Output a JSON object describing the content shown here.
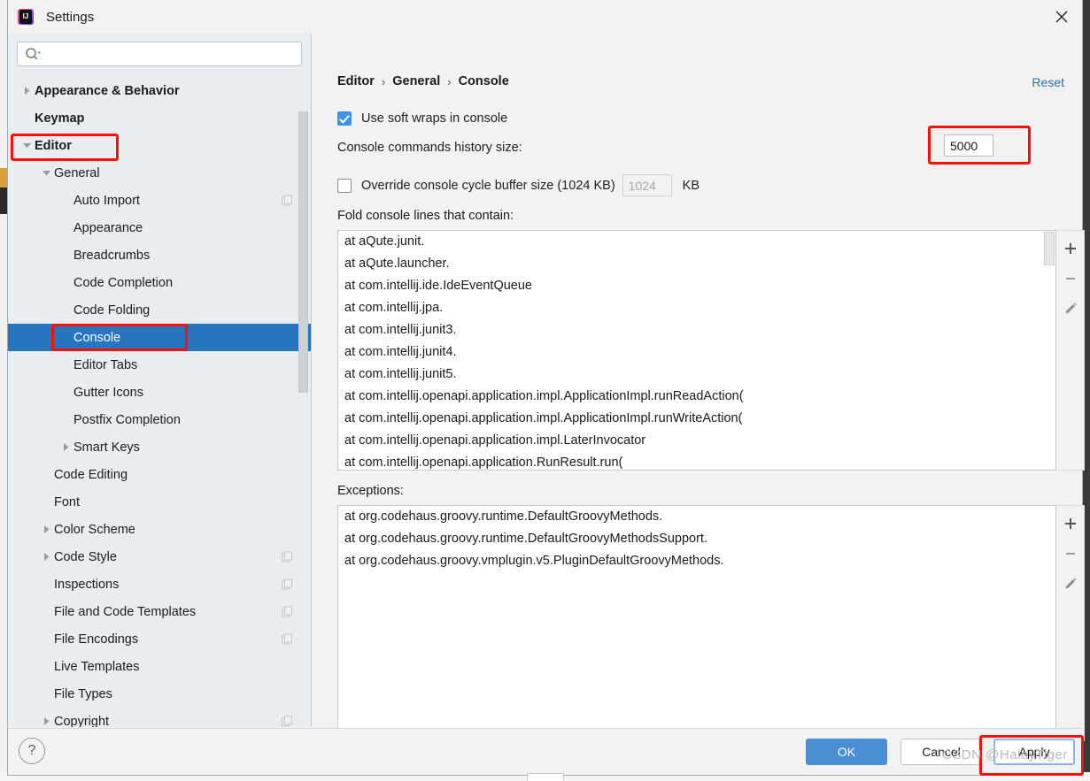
{
  "window": {
    "title": "Settings",
    "app_icon": "intellij-idea-icon",
    "close_icon": "close-icon"
  },
  "sidebar": {
    "search": {
      "placeholder": "",
      "value": "",
      "icon": "search-icon"
    },
    "items": [
      {
        "label": "Appearance & Behavior",
        "indent": 0,
        "arrow": "collapsed",
        "bold": true,
        "selected": false,
        "badge": false
      },
      {
        "label": "Keymap",
        "indent": 0,
        "arrow": "none",
        "bold": true,
        "selected": false,
        "badge": false
      },
      {
        "label": "Editor",
        "indent": 0,
        "arrow": "expanded",
        "bold": true,
        "selected": false,
        "badge": false
      },
      {
        "label": "General",
        "indent": 1,
        "arrow": "expanded",
        "bold": false,
        "selected": false,
        "badge": false
      },
      {
        "label": "Auto Import",
        "indent": 2,
        "arrow": "none",
        "bold": false,
        "selected": false,
        "badge": true
      },
      {
        "label": "Appearance",
        "indent": 2,
        "arrow": "none",
        "bold": false,
        "selected": false,
        "badge": false
      },
      {
        "label": "Breadcrumbs",
        "indent": 2,
        "arrow": "none",
        "bold": false,
        "selected": false,
        "badge": false
      },
      {
        "label": "Code Completion",
        "indent": 2,
        "arrow": "none",
        "bold": false,
        "selected": false,
        "badge": false
      },
      {
        "label": "Code Folding",
        "indent": 2,
        "arrow": "none",
        "bold": false,
        "selected": false,
        "badge": false
      },
      {
        "label": "Console",
        "indent": 2,
        "arrow": "none",
        "bold": false,
        "selected": true,
        "badge": false
      },
      {
        "label": "Editor Tabs",
        "indent": 2,
        "arrow": "none",
        "bold": false,
        "selected": false,
        "badge": false
      },
      {
        "label": "Gutter Icons",
        "indent": 2,
        "arrow": "none",
        "bold": false,
        "selected": false,
        "badge": false
      },
      {
        "label": "Postfix Completion",
        "indent": 2,
        "arrow": "none",
        "bold": false,
        "selected": false,
        "badge": false
      },
      {
        "label": "Smart Keys",
        "indent": 2,
        "arrow": "collapsed",
        "bold": false,
        "selected": false,
        "badge": false
      },
      {
        "label": "Code Editing",
        "indent": 1,
        "arrow": "none",
        "bold": false,
        "selected": false,
        "badge": false
      },
      {
        "label": "Font",
        "indent": 1,
        "arrow": "none",
        "bold": false,
        "selected": false,
        "badge": false
      },
      {
        "label": "Color Scheme",
        "indent": 1,
        "arrow": "collapsed",
        "bold": false,
        "selected": false,
        "badge": false
      },
      {
        "label": "Code Style",
        "indent": 1,
        "arrow": "collapsed",
        "bold": false,
        "selected": false,
        "badge": true
      },
      {
        "label": "Inspections",
        "indent": 1,
        "arrow": "none",
        "bold": false,
        "selected": false,
        "badge": true
      },
      {
        "label": "File and Code Templates",
        "indent": 1,
        "arrow": "none",
        "bold": false,
        "selected": false,
        "badge": true
      },
      {
        "label": "File Encodings",
        "indent": 1,
        "arrow": "none",
        "bold": false,
        "selected": false,
        "badge": true
      },
      {
        "label": "Live Templates",
        "indent": 1,
        "arrow": "none",
        "bold": false,
        "selected": false,
        "badge": false
      },
      {
        "label": "File Types",
        "indent": 1,
        "arrow": "none",
        "bold": false,
        "selected": false,
        "badge": false
      },
      {
        "label": "Copyright",
        "indent": 1,
        "arrow": "collapsed",
        "bold": false,
        "selected": false,
        "badge": true
      }
    ]
  },
  "main": {
    "breadcrumb": [
      "Editor",
      "General",
      "Console"
    ],
    "breadcrumb_separator": "›",
    "reset_label": "Reset",
    "soft_wraps": {
      "label": "Use soft wraps in console",
      "checked": true
    },
    "history": {
      "label": "Console commands history size:",
      "value": "5000"
    },
    "override": {
      "label": "Override console cycle buffer size (1024 KB)",
      "checked": false,
      "value": "1024",
      "unit": "KB"
    },
    "fold": {
      "label": "Fold console lines that contain:",
      "items": [
        "at aQute.junit.",
        "at aQute.launcher.",
        "at com.intellij.ide.IdeEventQueue",
        "at com.intellij.jpa.",
        "at com.intellij.junit3.",
        "at com.intellij.junit4.",
        "at com.intellij.junit5.",
        "at com.intellij.openapi.application.impl.ApplicationImpl.runReadAction(",
        "at com.intellij.openapi.application.impl.ApplicationImpl.runWriteAction(",
        "at com.intellij.openapi.application.impl.LaterInvocator",
        "at com.intellij.openapi.application.RunResult.run("
      ]
    },
    "exceptions": {
      "label": "Exceptions:",
      "items": [
        "at org.codehaus.groovy.runtime.DefaultGroovyMethods.",
        "at org.codehaus.groovy.runtime.DefaultGroovyMethodsSupport.",
        "at org.codehaus.groovy.vmplugin.v5.PluginDefaultGroovyMethods."
      ]
    },
    "list_toolbar": {
      "add_icon": "plus-icon",
      "remove_icon": "minus-icon",
      "edit_icon": "pencil-icon"
    }
  },
  "footer": {
    "help_label": "?",
    "ok_label": "OK",
    "cancel_label": "Cancel",
    "apply_label": "Apply"
  },
  "watermark": "CSDN @HaleyTiger",
  "colors": {
    "selection_blue": "#2675bf",
    "accent_blue": "#4a8fd4",
    "link_blue": "#2470b3",
    "highlight_red": "#fc0f07",
    "sidebar_bg": "#e8edf1",
    "panel_bg": "#f2f2f2"
  }
}
